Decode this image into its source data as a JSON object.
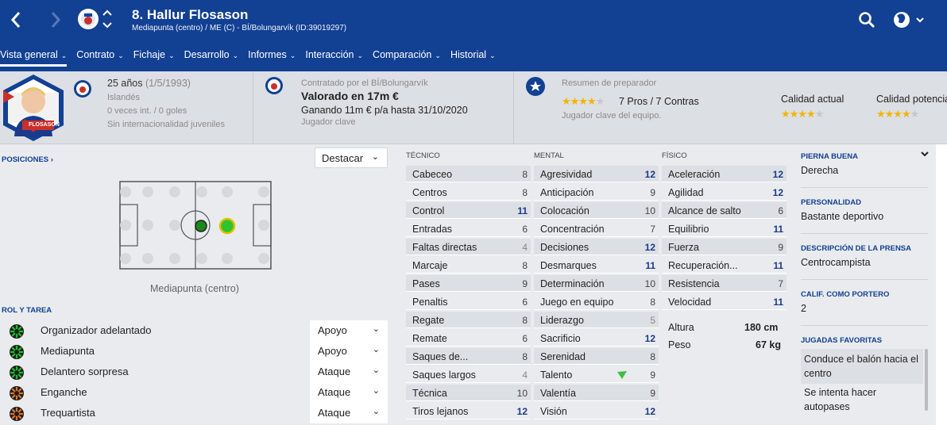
{
  "header": {
    "player_title": "8. Hallur Flosason",
    "subtitle": "Mediapunta (centro) / ME (C) - BÍ/Bolungarvík (ID:39019297)",
    "menu": [
      {
        "label": "Vista general",
        "active": true
      },
      {
        "label": "Contrato"
      },
      {
        "label": "Fichaje"
      },
      {
        "label": "Desarrollo"
      },
      {
        "label": "Informes"
      },
      {
        "label": "Interacción"
      },
      {
        "label": "Comparación"
      },
      {
        "label": "Historial"
      }
    ],
    "colors": {
      "bar": "#124093"
    }
  },
  "profile": {
    "age": "25 años",
    "dob": "(1/5/1993)",
    "nationality": "Islandés",
    "caps": "0 veces int. / 0 goles",
    "youth": "Sin internacionalidad juveniles",
    "photo_name": "FLOSASON"
  },
  "contract": {
    "label": "Contratado por el BÍ/Bolungarvík",
    "value": "Valorado en 17m €",
    "wage": "Ganando 11m € p/a hasta 31/10/2020",
    "role": "Jugador clave"
  },
  "coach": {
    "label": "Resumen de preparador",
    "stars": 4,
    "pros": "7 Pros / 7 Contras",
    "note": "Jugador clave del equipo.",
    "current_label": "Calidad actual",
    "current_stars": 4,
    "potential_label": "Calidad potencial",
    "potential_stars": 4
  },
  "positions": {
    "link": "POSICIONES",
    "highlight": "Destacar",
    "position_name": "Mediapunta (centro)"
  },
  "roles": {
    "title": "ROL Y TAREA",
    "items": [
      {
        "name": "Organizador adelantado",
        "duty": "Apoyo",
        "color": "#1fbf2a"
      },
      {
        "name": "Mediapunta",
        "duty": "Apoyo",
        "color": "#1fbf2a"
      },
      {
        "name": "Delantero sorpresa",
        "duty": "Ataque",
        "color": "#1fbf2a"
      },
      {
        "name": "Enganche",
        "duty": "Ataque",
        "color": "#e0732a"
      },
      {
        "name": "Trequartista",
        "duty": "Ataque",
        "color": "#e0732a"
      }
    ]
  },
  "attributes": {
    "tecnico_title": "TÉCNICO",
    "mental_title": "MENTAL",
    "fisico_title": "FÍSICO",
    "tecnico": [
      {
        "name": "Cabeceo",
        "value": "8"
      },
      {
        "name": "Centros",
        "value": "8"
      },
      {
        "name": "Control",
        "value": "11"
      },
      {
        "name": "Entradas",
        "value": "6"
      },
      {
        "name": "Faltas directas",
        "value": "4"
      },
      {
        "name": "Marcaje",
        "value": "8"
      },
      {
        "name": "Pases",
        "value": "9"
      },
      {
        "name": "Penaltis",
        "value": "6"
      },
      {
        "name": "Regate",
        "value": "8"
      },
      {
        "name": "Remate",
        "value": "6"
      },
      {
        "name": "Saques de...",
        "value": "8"
      },
      {
        "name": "Saques largos",
        "value": "4"
      },
      {
        "name": "Técnica",
        "value": "10"
      },
      {
        "name": "Tiros lejanos",
        "value": "12"
      }
    ],
    "mental": [
      {
        "name": "Agresividad",
        "value": "12"
      },
      {
        "name": "Anticipación",
        "value": "9"
      },
      {
        "name": "Colocación",
        "value": "10"
      },
      {
        "name": "Concentración",
        "value": "7"
      },
      {
        "name": "Decisiones",
        "value": "12"
      },
      {
        "name": "Desmarques",
        "value": "11"
      },
      {
        "name": "Determinación",
        "value": "10"
      },
      {
        "name": "Juego en equipo",
        "value": "8"
      },
      {
        "name": "Liderazgo",
        "value": "5"
      },
      {
        "name": "Sacrificio",
        "value": "12"
      },
      {
        "name": "Serenidad",
        "value": "8"
      },
      {
        "name": "Talento",
        "value": "9"
      },
      {
        "name": "Valentía",
        "value": "9"
      },
      {
        "name": "Visión",
        "value": "12"
      }
    ],
    "fisico": [
      {
        "name": "Aceleración",
        "value": "12"
      },
      {
        "name": "Agilidad",
        "value": "12"
      },
      {
        "name": "Alcance de salto",
        "value": "6"
      },
      {
        "name": "Equilibrio",
        "value": "11"
      },
      {
        "name": "Fuerza",
        "value": "9"
      },
      {
        "name": "Recuperación...",
        "value": "11"
      },
      {
        "name": "Resistencia",
        "value": "7"
      },
      {
        "name": "Velocidad",
        "value": "11"
      }
    ],
    "height_label": "Altura",
    "height": "180 cm",
    "weight_label": "Peso",
    "weight": "67 kg"
  },
  "details": {
    "foot_label": "PIERNA BUENA",
    "foot": "Derecha",
    "personality_label": "PERSONALIDAD",
    "personality": "Bastante deportivo",
    "press_label": "DESCRIPCIÓN DE LA PRENSA",
    "press": "Centrocampista",
    "gk_label": "CALIF. COMO PORTERO",
    "gk": "2",
    "plays_label": "JUGADAS FAVORITAS",
    "plays": [
      "Conduce el balón hacia el centro",
      "Se intenta hacer autopases"
    ]
  }
}
